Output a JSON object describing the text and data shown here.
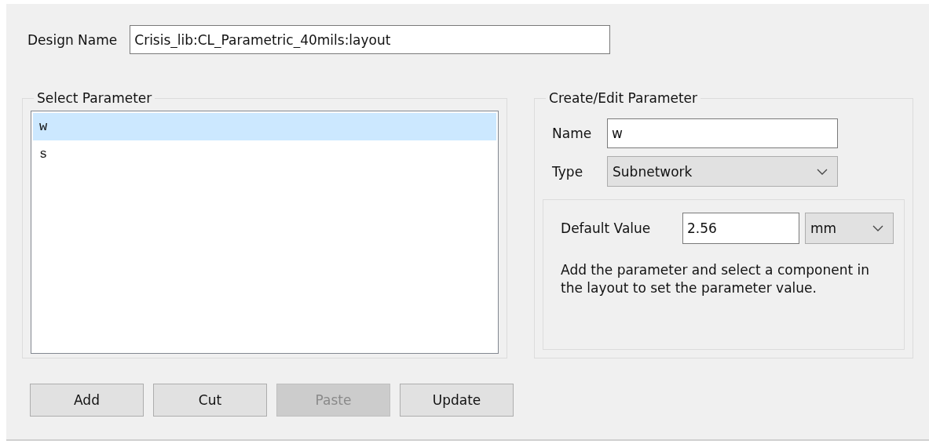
{
  "design_name": {
    "label": "Design Name",
    "value": "Crisis_lib:CL_Parametric_40mils:layout"
  },
  "select_parameter": {
    "title": "Select Parameter",
    "items": [
      {
        "name": "w",
        "selected": true
      },
      {
        "name": "s",
        "selected": false
      }
    ]
  },
  "create_edit": {
    "title": "Create/Edit Parameter",
    "name_label": "Name",
    "name_value": "w",
    "type_label": "Type",
    "type_value": "Subnetwork",
    "default_label": "Default Value",
    "default_value": "2.56",
    "unit": "mm",
    "hint": "Add the parameter and select a component in the layout to set the parameter value."
  },
  "buttons": [
    {
      "label": "Add",
      "disabled": false
    },
    {
      "label": "Cut",
      "disabled": false
    },
    {
      "label": "Paste",
      "disabled": true
    },
    {
      "label": "Update",
      "disabled": false
    }
  ]
}
